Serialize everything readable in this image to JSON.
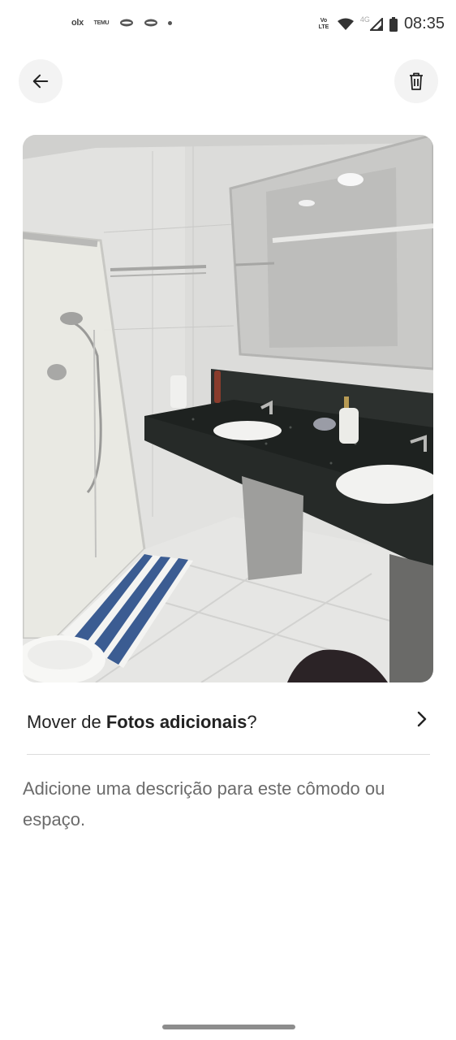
{
  "status_bar": {
    "app_icons": [
      "olx",
      "TEMU"
    ],
    "network": "4G",
    "volte": "Vo LTE",
    "time": "08:35"
  },
  "header": {
    "back_icon": "arrow-left-icon",
    "delete_icon": "trash-icon"
  },
  "photo": {
    "subject": "bathroom"
  },
  "move_row": {
    "prefix": "Mover de ",
    "section_name": "Fotos adicionais",
    "suffix": "?"
  },
  "description_hint": "Adicione uma descrição para este cômodo ou espaço.",
  "colors": {
    "background": "#ffffff",
    "button_bg": "#f3f3f3",
    "hint_text": "#6b6b6b",
    "divider": "#dcdcdc"
  }
}
